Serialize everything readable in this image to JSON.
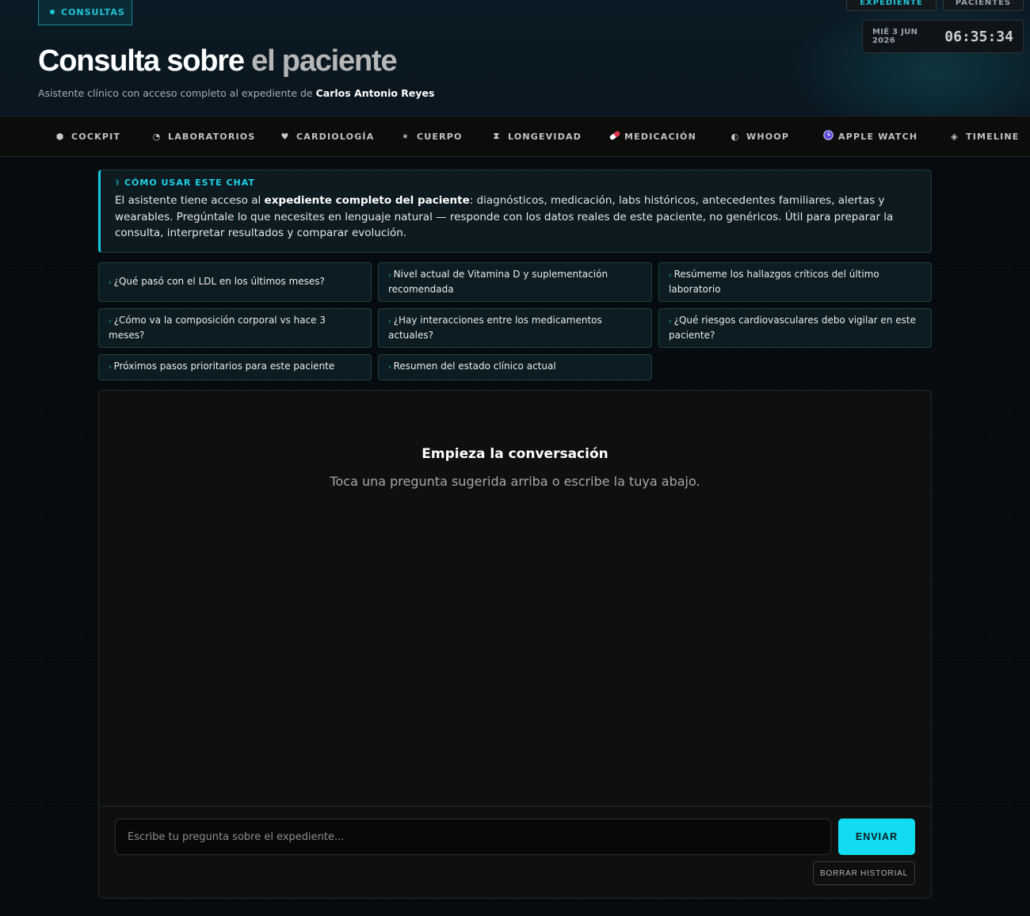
{
  "header": {
    "section_label": "CONSULTAS",
    "top_buttons": [
      "EXPEDIENTE",
      "PACIENTES"
    ],
    "date": "MIÉ 3 JUN 2026",
    "time": "06:35:34",
    "title_main": "Consulta sobre",
    "title_accent": "el paciente",
    "subtitle_prefix": "Asistente clínico con acceso completo al expediente de",
    "patient_name": "Carlos Antonio Reyes"
  },
  "nav": [
    {
      "label": "COCKPIT",
      "icon": "hexagon-icon"
    },
    {
      "label": "LABORATORIOS",
      "icon": "pie-chart-icon"
    },
    {
      "label": "CARDIOLOGÍA",
      "icon": "heart-icon"
    },
    {
      "label": "CUERPO",
      "icon": "asterisk-icon"
    },
    {
      "label": "LONGEVIDAD",
      "icon": "hourglass-icon"
    },
    {
      "label": "MEDICACIÓN",
      "icon": "pill-icon"
    },
    {
      "label": "WHOOP",
      "icon": "half-circle-icon"
    },
    {
      "label": "APPLE WATCH",
      "icon": "watch-icon"
    },
    {
      "label": "TIMELINE",
      "icon": "diamond-icon"
    }
  ],
  "help": {
    "title": "CÓMO USAR ESTE CHAT",
    "line1_prefix": "El asistente tiene acceso al",
    "line1_bold": "expediente completo del paciente",
    "line1_suffix": ": diagnósticos, medicación, labs históricos, antecedentes familiares, alertas y wearables. Pregúntale lo que necesites en lenguaje natural — responde con los datos reales de este paciente, no genéricos. Útil para preparar la consulta, interpretar resultados y comparar evolución."
  },
  "suggestions": [
    "¿Qué pasó con el LDL en los últimos meses?",
    "Nivel actual de Vitamina D y suplementación recomendada",
    "Resúmeme los hallazgos críticos del último laboratorio",
    "¿Cómo va la composición corporal vs hace 3 meses?",
    "¿Hay interacciones entre los medicamentos actuales?",
    "¿Qué riesgos cardiovasculares debo vigilar en este paciente?",
    "Próximos pasos prioritarios para este paciente",
    "Resumen del estado clínico actual"
  ],
  "chat": {
    "empty_title": "Empieza la conversación",
    "empty_subtitle": "Toca una pregunta sugerida arriba o escribe la tuya abajo.",
    "input_placeholder": "Escribe tu pregunta sobre el expediente...",
    "send_label": "ENVIAR",
    "clear_label": "BORRAR HISTORIAL"
  },
  "colors": {
    "accent": "#12dcf2",
    "header_bg": "#0b1a24",
    "page_bg": "#060b10"
  }
}
